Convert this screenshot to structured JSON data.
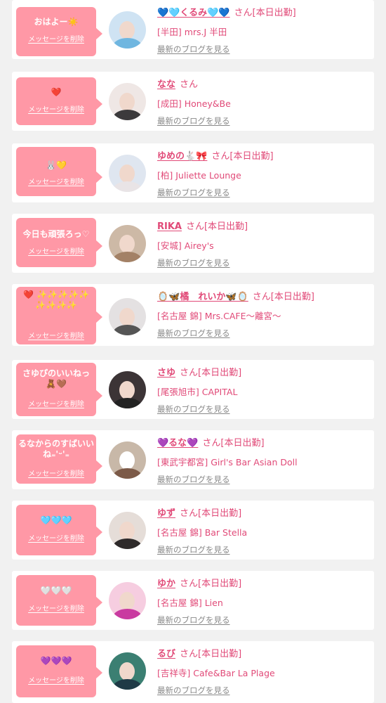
{
  "delete_label": "メッセージを削除",
  "blog_label": "最新のブログを見る",
  "colors": {
    "accent": "#e14a78",
    "bubble": "#ff98a6",
    "background": "#f1f1f1"
  },
  "messages": [
    {
      "message": "おはよー☀️",
      "name": "💙🩵くるみ🩵💙",
      "suffix": "さん[本日出勤]",
      "shop": "[半田] mrs.J 半田"
    },
    {
      "message": "❤️",
      "name": "なな",
      "suffix": "さん",
      "shop": "[成田] Honey&Be"
    },
    {
      "message": "🐰💛",
      "name": "ゆめの🐇🎀",
      "suffix": "さん[本日出勤]",
      "shop": "[柏] Juliette Lounge"
    },
    {
      "message": "今日も頑張ろっ♡",
      "name": "RIKA",
      "suffix": "さん[本日出勤]",
      "shop": "[安城] Airey's"
    },
    {
      "message": "❤️ ✨✨✨✨✨ ✨✨✨✨",
      "name": "🪞🦋橘　れいか🦋🪞",
      "suffix": "さん[本日出勤]",
      "shop": "[名古屋 錦] Mrs.CAFE〜離宮〜"
    },
    {
      "message": "さゆぴのいいねっ🧸🤎",
      "name": "さゆ",
      "suffix": "さん[本日出勤]",
      "shop": "[尾張旭市] CAPITAL"
    },
    {
      "message": "るなからのすばいいね₌'ᵕ'₌",
      "name": "💜るな💜",
      "suffix": "さん[本日出勤]",
      "shop": "[東武宇都宮] Girl's Bar Asian Doll"
    },
    {
      "message": "🩵🩵🩵",
      "name": "ゆず",
      "suffix": "さん[本日出勤]",
      "shop": "[名古屋 錦] Bar Stella"
    },
    {
      "message": "🤍🤍🤍",
      "name": "ゆか",
      "suffix": "さん[本日出勤]",
      "shop": "[名古屋 錦] Lien"
    },
    {
      "message": "💜💜💜",
      "name": "るび",
      "suffix": "さん[本日出勤]",
      "shop": "[吉祥寺] Cafe&Bar La Plage"
    }
  ]
}
